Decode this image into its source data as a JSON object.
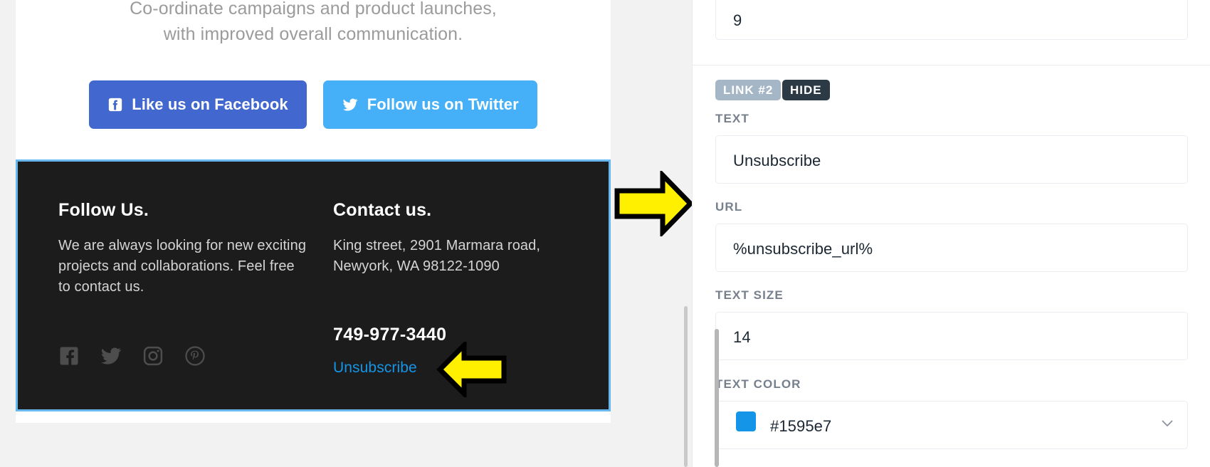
{
  "preview": {
    "intro_line1": "Co-ordinate campaigns and product launches,",
    "intro_line2": "with improved overall communication.",
    "facebook_button": "Like us on Facebook",
    "twitter_button": "Follow us on Twitter",
    "facebook_color": "#4267cf",
    "twitter_color": "#45b0f7",
    "footer": {
      "background": "#1c1c1c",
      "selection_color": "#67b8ef",
      "follow_heading": "Follow Us.",
      "follow_body": "We are always looking for new exciting projects and collaborations. Feel free to contact us.",
      "contact_heading": "Contact us.",
      "contact_address_line1": "King street, 2901 Marmara road,",
      "contact_address_line2": "Newyork, WA 98122-1090",
      "phone": "749-977-3440",
      "unsubscribe_label": "Unsubscribe",
      "unsubscribe_color": "#1595e7",
      "social_icons": [
        "facebook-icon",
        "twitter-icon",
        "instagram-icon",
        "pinterest-icon"
      ]
    }
  },
  "annotations": {
    "arrow_right": "arrow-right-icon",
    "arrow_left": "arrow-left-icon",
    "arrow_color": "#fff000"
  },
  "properties": {
    "top_field_value": "9",
    "link_badge": "LINK #2",
    "hide_badge": "HIDE",
    "fields": [
      {
        "label": "TEXT",
        "value": "Unsubscribe"
      },
      {
        "label": "URL",
        "value": "%unsubscribe_url%"
      },
      {
        "label": "TEXT SIZE",
        "value": "14"
      },
      {
        "label": "TEXT COLOR",
        "value": "#1595e7"
      }
    ],
    "text_color_swatch": "#1595e7"
  }
}
